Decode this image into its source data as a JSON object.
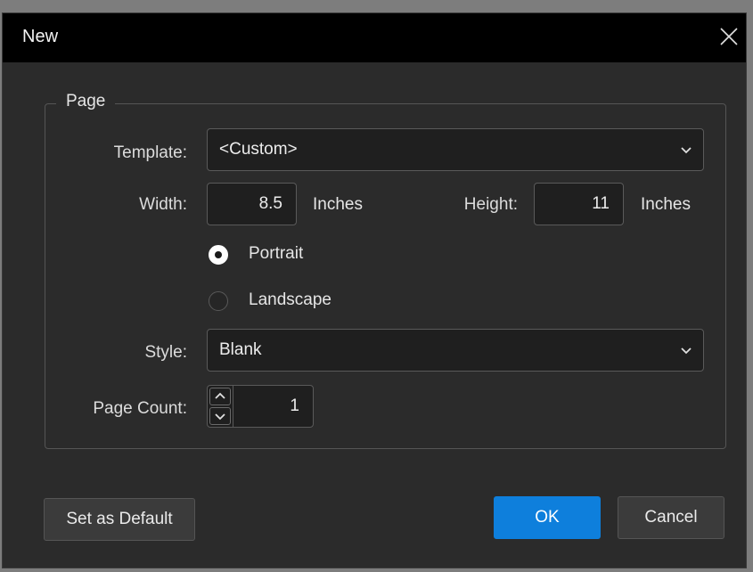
{
  "dialog": {
    "title": "New",
    "close_icon": "close-icon"
  },
  "page_group": {
    "legend": "Page",
    "template": {
      "label": "Template:",
      "value": "<Custom>"
    },
    "width": {
      "label": "Width:",
      "value": "8.5",
      "unit": "Inches"
    },
    "height": {
      "label": "Height:",
      "value": "11",
      "unit": "Inches"
    },
    "orientation": {
      "selected": "Portrait",
      "options": [
        "Portrait",
        "Landscape"
      ]
    },
    "style": {
      "label": "Style:",
      "value": "Blank"
    },
    "page_count": {
      "label": "Page Count:",
      "value": "1"
    }
  },
  "buttons": {
    "set_default": "Set as Default",
    "ok": "OK",
    "cancel": "Cancel"
  },
  "colors": {
    "titlebar": "#000000",
    "background": "#2b2b2b",
    "primary": "#0e7fdc"
  }
}
